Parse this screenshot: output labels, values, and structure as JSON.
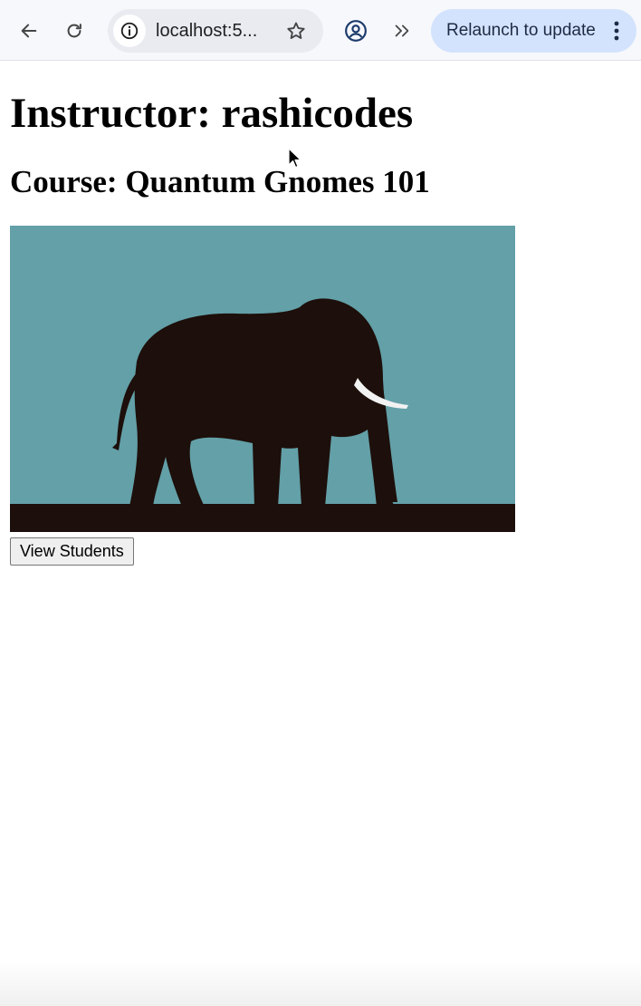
{
  "browser": {
    "url": "localhost:5...",
    "relaunch_label": "Relaunch to update",
    "icons": {
      "back": "back-arrow-icon",
      "reload": "reload-icon",
      "info": "info-icon",
      "bookmark": "star-icon",
      "profile": "profile-icon",
      "more_extensions": "double-chevron-icon",
      "menu": "kebab-menu-icon"
    },
    "colors": {
      "toolbar_bg": "#f7f8fc",
      "omnibox_bg": "#e9ebf1",
      "relaunch_bg": "#d3e3fd"
    }
  },
  "page": {
    "instructor_heading": "Instructor: rashicodes",
    "course_heading": "Course: Quantum Gnomes 101",
    "course_image": {
      "subject": "elephant silhouette",
      "colors": {
        "sky": "#63a0a8",
        "silhouette": "#1d0f0b",
        "tusk": "#f2f2f2"
      }
    },
    "view_students_label": "View Students"
  }
}
